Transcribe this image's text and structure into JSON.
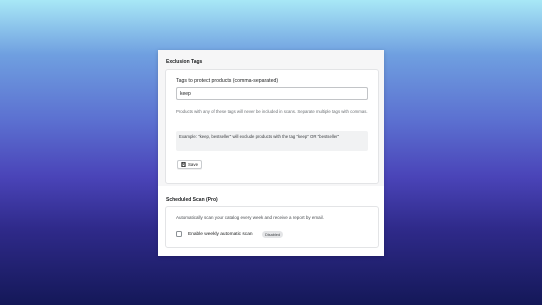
{
  "exclusion": {
    "title": "Exclusion Tags",
    "field_label": "Tags to protect products (comma-separated)",
    "field_value": "keep",
    "help_text": "Products with any of these tags will never be included in scans. Separate multiple tags with commas.",
    "example_text": "Example: \"keep, bestseller\" will exclude products with the tag \"keep\" OR \"bestseller\"",
    "save_label": "Save",
    "save_icon": "floppy-disk-icon"
  },
  "scheduled": {
    "title": "Scheduled Scan (Pro)",
    "description": "Automatically scan your catalog every week and receive a report by email.",
    "checkbox_label": "Enable weekly automatic scan",
    "checkbox_checked": false,
    "status_badge": "Disabled"
  },
  "colors": {
    "background_top": "#a8e8f6",
    "background_bottom": "#141858",
    "panel": "#ffffff",
    "border": "#e3e4e6"
  }
}
